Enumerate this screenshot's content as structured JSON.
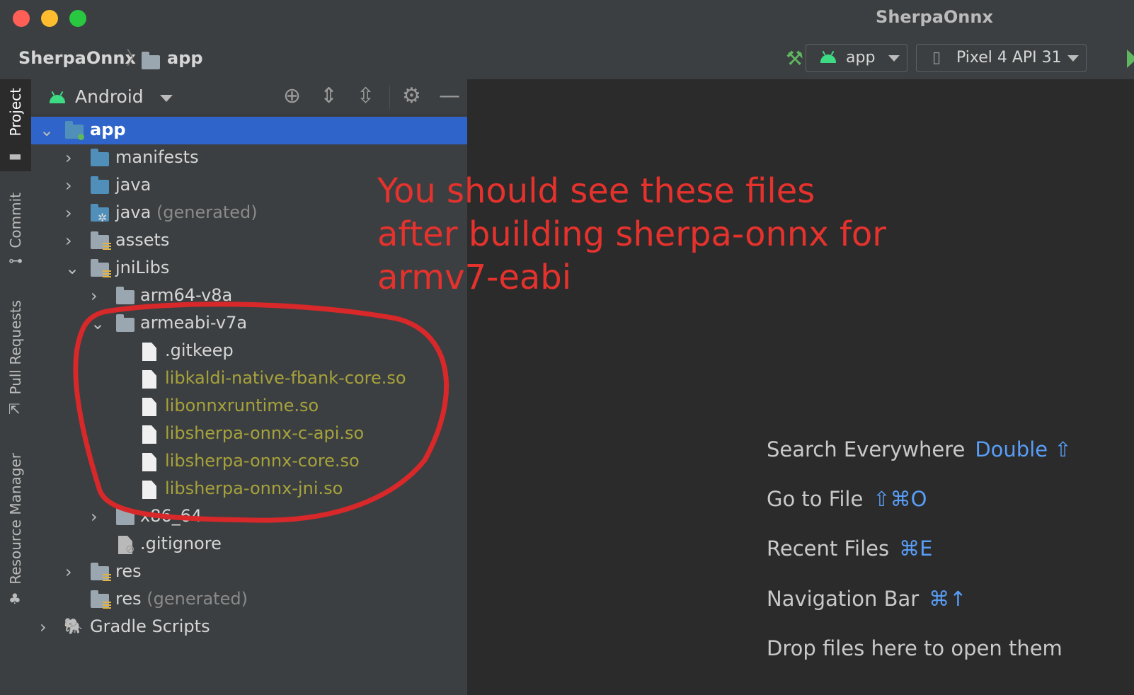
{
  "window": {
    "title": "SherpaOnnx"
  },
  "navbar": {
    "breadcrumb": [
      "SherpaOnnx",
      "app"
    ],
    "run_config": "app",
    "device": "Pixel 4 API 31"
  },
  "toolstrip": {
    "tabs": [
      "Project",
      "Commit",
      "Pull Requests",
      "Resource Manager"
    ]
  },
  "project_panel": {
    "view_mode": "Android",
    "tree": [
      {
        "label": "app"
      },
      {
        "label": "manifests"
      },
      {
        "label": "java"
      },
      {
        "label": "java",
        "suffix": "(generated)"
      },
      {
        "label": "assets"
      },
      {
        "label": "jniLibs"
      },
      {
        "label": "arm64-v8a"
      },
      {
        "label": "armeabi-v7a"
      },
      {
        "label": ".gitkeep"
      },
      {
        "label": "libkaldi-native-fbank-core.so"
      },
      {
        "label": "libonnxruntime.so"
      },
      {
        "label": "libsherpa-onnx-c-api.so"
      },
      {
        "label": "libsherpa-onnx-core.so"
      },
      {
        "label": "libsherpa-onnx-jni.so"
      },
      {
        "label": "x86_64"
      },
      {
        "label": ".gitignore"
      },
      {
        "label": "res"
      },
      {
        "label": "res",
        "suffix": "(generated)"
      },
      {
        "label": "Gradle Scripts"
      }
    ]
  },
  "editor": {
    "hints": [
      {
        "label": "Search Everywhere",
        "shortcut": "Double ⇧"
      },
      {
        "label": "Go to File",
        "shortcut": "⇧⌘O"
      },
      {
        "label": "Recent Files",
        "shortcut": "⌘E"
      },
      {
        "label": "Navigation Bar",
        "shortcut": "⌘↑"
      },
      {
        "label": "Drop files here to open them",
        "shortcut": ""
      }
    ]
  },
  "annotation": {
    "lines": [
      "You should see these files",
      "after building sherpa-onnx for",
      "armv7-eabi"
    ],
    "color": "#e5322d"
  },
  "colors": {
    "selection": "#2f65ca",
    "accent_blue": "#589df6",
    "modified_file": "#a6a23b"
  }
}
